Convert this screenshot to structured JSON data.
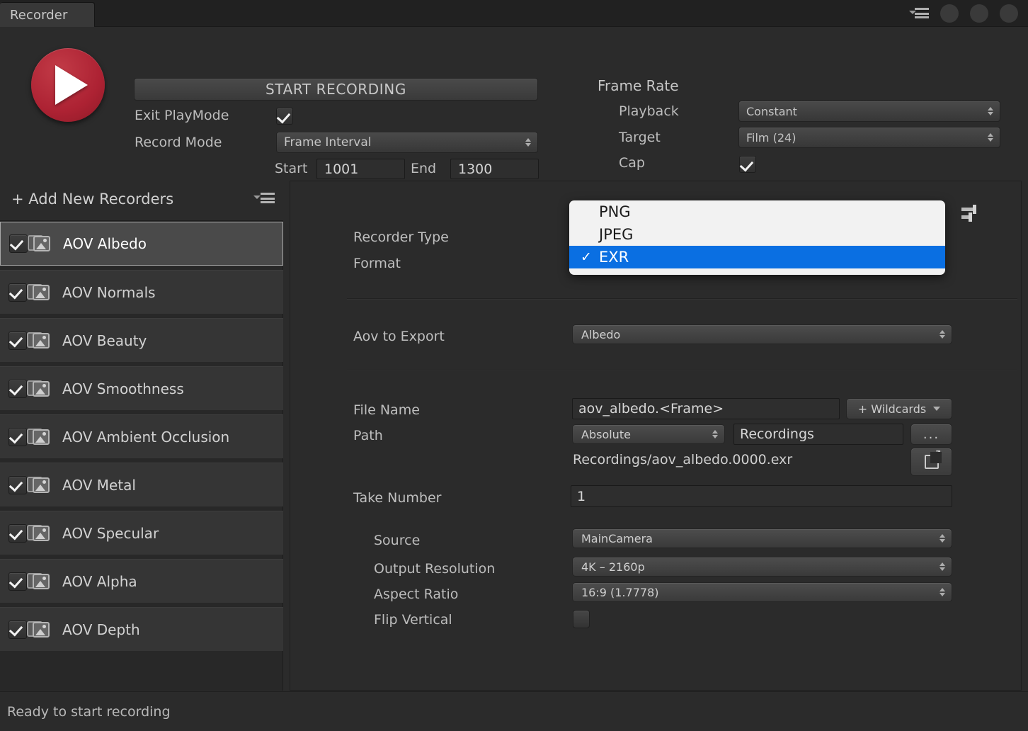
{
  "window": {
    "tab_label": "Recorder",
    "accent_record_color": "#ad2233",
    "popup_highlight_color": "#0a6fe2"
  },
  "header": {
    "start_recording_label": "START RECORDING",
    "exit_playmode_label": "Exit PlayMode",
    "exit_playmode_checked": true,
    "record_mode_label": "Record Mode",
    "record_mode_value": "Frame Interval",
    "start_label": "Start",
    "start_value": "1001",
    "end_label": "End",
    "end_value": "1300",
    "frame_rate_title": "Frame Rate",
    "playback_label": "Playback",
    "playback_value": "Constant",
    "target_label": "Target",
    "target_value": "Film (24)",
    "cap_label": "Cap",
    "cap_checked": true
  },
  "sidebar": {
    "add_label": "+ Add New Recorders",
    "items": [
      {
        "label": "AOV Albedo",
        "checked": true,
        "selected": true
      },
      {
        "label": "AOV Normals",
        "checked": true,
        "selected": false
      },
      {
        "label": "AOV Beauty",
        "checked": true,
        "selected": false
      },
      {
        "label": "AOV Smoothness",
        "checked": true,
        "selected": false
      },
      {
        "label": "AOV Ambient Occlusion",
        "checked": true,
        "selected": false
      },
      {
        "label": "AOV Metal",
        "checked": true,
        "selected": false
      },
      {
        "label": "AOV Specular",
        "checked": true,
        "selected": false
      },
      {
        "label": "AOV Alpha",
        "checked": true,
        "selected": false
      },
      {
        "label": "AOV Depth",
        "checked": true,
        "selected": false
      }
    ]
  },
  "details": {
    "recorder_type_label": "Recorder Type",
    "format_label": "Format",
    "aov_to_export_label": "Aov to Export",
    "aov_to_export_value": "Albedo",
    "file_name_label": "File Name",
    "file_name_value": "aov_albedo.<Frame>",
    "wildcards_label": "+ Wildcards",
    "path_label": "Path",
    "path_mode_value": "Absolute",
    "path_value": "Recordings",
    "browse_label": "...",
    "resolved_path": "Recordings/aov_albedo.0000.exr",
    "take_number_label": "Take Number",
    "take_number_value": "1",
    "source_label": "Source",
    "source_value": "MainCamera",
    "output_resolution_label": "Output Resolution",
    "output_resolution_value": "4K – 2160p",
    "aspect_ratio_label": "Aspect Ratio",
    "aspect_ratio_value": "16:9 (1.7778)",
    "flip_vertical_label": "Flip Vertical",
    "flip_vertical_checked": false
  },
  "format_popup": {
    "options": [
      {
        "label": "PNG",
        "selected": false
      },
      {
        "label": "JPEG",
        "selected": false
      },
      {
        "label": "EXR",
        "selected": true
      }
    ],
    "checkmark": "✓"
  },
  "status": {
    "message": "Ready to start recording"
  }
}
